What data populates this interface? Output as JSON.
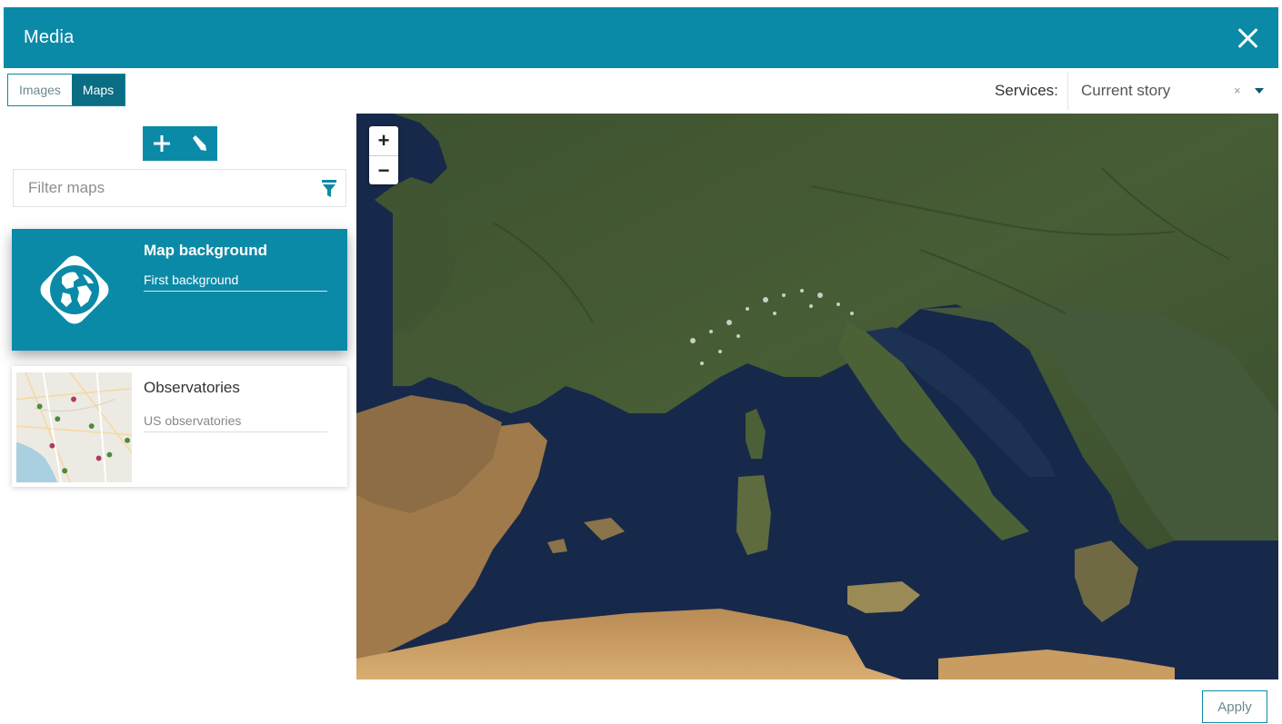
{
  "dialog": {
    "title": "Media",
    "close_icon": "close-icon"
  },
  "tabs": [
    {
      "label": "Images",
      "active": false
    },
    {
      "label": "Maps",
      "active": true
    }
  ],
  "services": {
    "label": "Services:",
    "value": "Current story",
    "clear": "×"
  },
  "sidebar": {
    "actions": [
      "plus-icon",
      "pencil-icon"
    ],
    "filter": {
      "placeholder": "Filter maps",
      "icon": "filter-icon"
    },
    "maps": [
      {
        "title": "Map background",
        "description": "First background",
        "selected": true,
        "thumb_icon": "globe-map-icon"
      },
      {
        "title": "Observatories",
        "description": "US observatories",
        "selected": false,
        "thumb_icon": "map-thumbnail"
      }
    ]
  },
  "map": {
    "zoom_in": "+",
    "zoom_out": "−"
  },
  "footer": {
    "apply_label": "Apply"
  },
  "colors": {
    "accent": "#0b8aa8",
    "accent_dark": "#0a6d83"
  }
}
